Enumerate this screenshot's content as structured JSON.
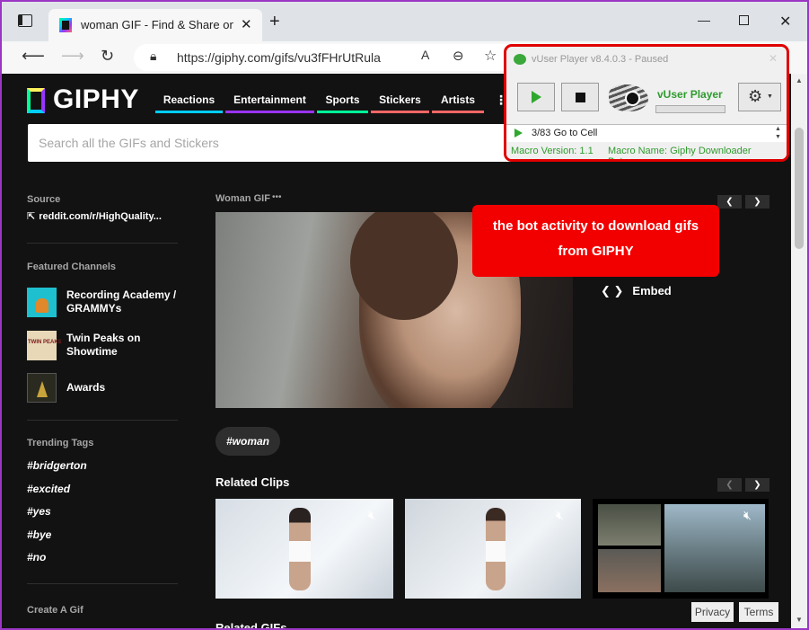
{
  "browser": {
    "tab_title": "woman GIF - Find & Share on GIPHY",
    "url": "https://giphy.com/gifs/vu3fFHrUtRula"
  },
  "giphy": {
    "logo": "GIPHY",
    "nav": [
      "Reactions",
      "Entertainment",
      "Sports",
      "Stickers",
      "Artists"
    ],
    "search_placeholder": "Search all the GIFs and Stickers",
    "source_heading": "Source",
    "source_link": "reddit.com/r/HighQuality...",
    "featured_heading": "Featured Channels",
    "channels": [
      {
        "label": "Recording Academy / GRAMMYs"
      },
      {
        "label": "Twin Peaks on Showtime",
        "thumb_text": "TWIN PEAKS"
      },
      {
        "label": "Awards"
      }
    ],
    "trending_heading": "Trending Tags",
    "tags": [
      "#bridgerton",
      "#excited",
      "#yes",
      "#bye",
      "#no"
    ],
    "create_gif": "Create A Gif",
    "gif_title": "Woman GIF",
    "gif_more": "•••",
    "embed_label": "Embed",
    "woman_tag": "#woman",
    "related_clips": "Related Clips",
    "related_gifs": "Related GIFs",
    "privacy": "Privacy",
    "terms": "Terms"
  },
  "callout": {
    "line1": "the bot activity to download gifs",
    "line2": "from GIPHY"
  },
  "player": {
    "title": "vUser Player v8.4.0.3 - Paused",
    "brand": "vUser Player",
    "status": "3/83 Go to Cell",
    "macro_version": "Macro Version: 1.1",
    "macro_name": "Macro Name: Giphy Downloader Bot.vum"
  },
  "colors": {
    "giphy_bg": "#121212",
    "callout": "#f20000",
    "player_border": "#e00000",
    "player_green": "#2e9b2e"
  }
}
